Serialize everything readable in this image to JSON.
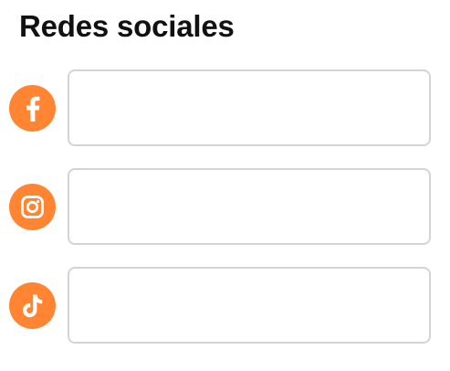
{
  "section": {
    "title": "Redes sociales"
  },
  "colors": {
    "accent": "#FF8533",
    "border": "#D4D4D4",
    "title": "#111111"
  },
  "social_fields": [
    {
      "network": "facebook",
      "icon": "facebook-icon",
      "value": "",
      "placeholder": ""
    },
    {
      "network": "instagram",
      "icon": "instagram-icon",
      "value": "",
      "placeholder": ""
    },
    {
      "network": "tiktok",
      "icon": "tiktok-icon",
      "value": "",
      "placeholder": ""
    }
  ]
}
